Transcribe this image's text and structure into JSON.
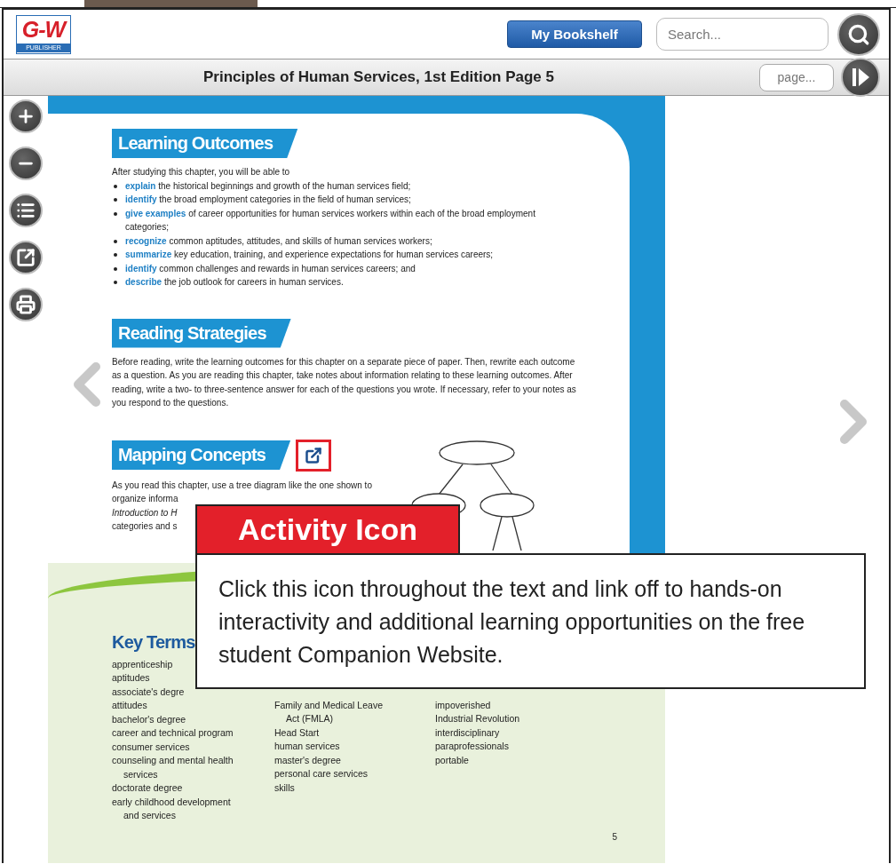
{
  "header": {
    "logo": {
      "mark": "G-W",
      "subtitle": "PUBLISHER"
    },
    "bookshelf_button": "My Bookshelf",
    "search": {
      "placeholder": "Search..."
    }
  },
  "title_bar": {
    "title": "Principles of Human Services, 1st Edition Page 5",
    "page_field": {
      "placeholder": "page..."
    }
  },
  "sections": [
    {
      "kind": "outcomes",
      "heading": "Learning Outcomes",
      "intro": "After studying this chapter, you will be able to",
      "items": [
        {
          "term": "explain",
          "text": "the historical beginnings and growth of the human services field;"
        },
        {
          "term": "identify",
          "text": "the broad employment categories in the field of human services;"
        },
        {
          "term": "give examples",
          "text": "of career opportunities for human services workers within each of the broad employment categories;"
        },
        {
          "term": "recognize",
          "text": "common aptitudes, attitudes, and skills of human services workers;"
        },
        {
          "term": "summarize",
          "text": "key education, training, and experience expectations for human services careers;"
        },
        {
          "term": "identify",
          "text": "common challenges and rewards in human services careers; and"
        },
        {
          "term": "describe",
          "text": "the job outlook for careers in human services."
        }
      ]
    },
    {
      "kind": "paragraph",
      "heading": "Reading Strategies",
      "text": "Before reading, write the learning outcomes for this chapter on a separate piece of paper. Then, rewrite each outcome as a question. As you are reading this chapter, take notes about information relating to these learning outcomes. After reading, write a two- to three-sentence answer for each of the questions you wrote. If necessary, refer to your notes as you respond to the questions."
    },
    {
      "kind": "mapping",
      "heading": "Mapping Concepts",
      "lines": [
        "As you read this chapter, use a tree diagram like the one shown to",
        "organize informa",
        "*Introduction to H*",
        "categories and s"
      ]
    }
  ],
  "key_terms": {
    "heading": "Key Terms",
    "columns": [
      [
        [
          "apprenticeship"
        ],
        [
          "aptitudes"
        ],
        [
          "associate's degre"
        ],
        [
          "attitudes"
        ],
        [
          "bachelor's degree"
        ],
        [
          "career and technical program"
        ],
        [
          "consumer services"
        ],
        [
          "counseling and mental health",
          "services"
        ],
        [
          "doctorate degree"
        ],
        [
          "early childhood development",
          "and services"
        ]
      ],
      [
        [
          "Family and Medical Leave",
          "Act (FMLA)"
        ],
        [
          "Head Start"
        ],
        [
          "human services"
        ],
        [
          "master's degree"
        ],
        [
          "personal care services"
        ],
        [
          "skills"
        ]
      ],
      [
        [
          "impoverished"
        ],
        [
          "Industrial Revolution"
        ],
        [
          "interdisciplinary"
        ],
        [
          "paraprofessionals"
        ],
        [
          "portable"
        ]
      ]
    ]
  },
  "page_number": "5",
  "callout": {
    "label": "Activity Icon",
    "text": "Click this icon throughout the text and link off to hands-on interactivity and additional learning opportunities on the free student Companion Website."
  }
}
